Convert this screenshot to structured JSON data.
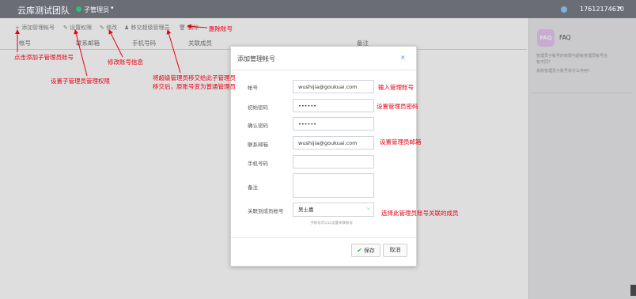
{
  "topbar": {
    "team_name": "云库测试团队",
    "role_label": "子管理员",
    "role_caret": "▾",
    "user_phone": "17612174610",
    "user_caret": "▾"
  },
  "toolbar": {
    "add_label": "+ 添加管理帐号",
    "permissions_label": "✎ 设置权限",
    "edit_label": "✎ 修改",
    "transfer_label": "♟ 移交超级管理员",
    "delete_label": "🗑 删除"
  },
  "table": {
    "columns": [
      "帐号",
      "联系邮箱",
      "手机号码",
      "关联成员",
      "备注"
    ]
  },
  "faq": {
    "badge": "FAQ",
    "title": "FAQ",
    "lines": [
      "管理员子帐号的权限与超级管理员帐号也",
      "有不同?",
      "系统管理员子账号有什么作用?"
    ]
  },
  "modal": {
    "title": "添加管理帐号",
    "close": "×",
    "fields": {
      "account_label": "帐号",
      "account_value": "wushijia@goukuai.com",
      "init_password_label": "初始密码",
      "init_password_value": "••••••",
      "confirm_password_label": "确认密码",
      "confirm_password_value": "••••••",
      "email_label": "联系邮箱",
      "email_value": "wushijia@goukuai.com",
      "phone_label": "手机号码",
      "phone_value": "",
      "note_label": "备注",
      "note_value": "",
      "member_label": "关联到成员帐号",
      "member_value": "吴士嘉",
      "member_caret": "⌄"
    },
    "hint": "子帐号可以以设置关联帐号",
    "save_check": "✔",
    "save_label": "保存",
    "cancel_label": "取消"
  },
  "annotations": {
    "delete": "删除账号",
    "add": "点击添加子管理员账号",
    "permissions": "设置子管理员管理权限",
    "edit": "修改账号信息",
    "transfer_line1": "将超级管理员移交给此子管理员",
    "transfer_line2": "移交后，原账号变为普通管理员",
    "account": "输入管理账号",
    "password": "设置管理员密码",
    "email": "设置管理员邮箱",
    "member": "选择此管理员账号关联的成员"
  },
  "colors": {
    "topbar": "#6a6d74",
    "annotation": "#e60012",
    "accent": "#4a90e2",
    "role_dot": "#2cc07a"
  }
}
